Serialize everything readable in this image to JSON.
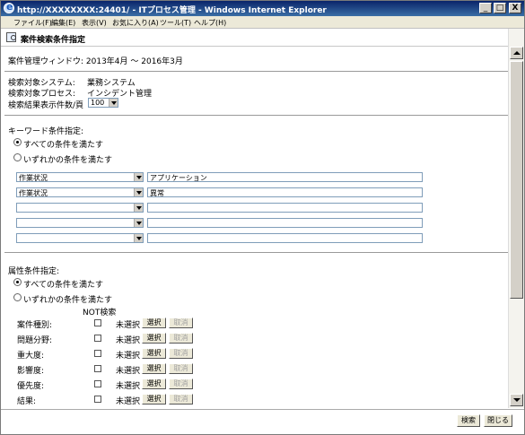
{
  "window": {
    "title": "http://XXXXXXXX:24401/ - ITプロセス管理 - Windows Internet Explorer",
    "minimize": "_",
    "maximize": "□",
    "close": "X"
  },
  "menu": [
    "ファイル(F)",
    "編集(E)",
    "表示(V)",
    "お気に入り(A)",
    "ツール(T)",
    "ヘルプ(H)"
  ],
  "page": {
    "title": "案件検索条件指定"
  },
  "window_period": "案件管理ウィンドウ: 2013年4月 ～ 2016年3月",
  "search_target": {
    "system_label": "検索対象システム:",
    "system_value": "業務システム",
    "process_label": "検索対象プロセス:",
    "process_value": "インシデント管理",
    "count_label": "検索結果表示件数/頁",
    "count_value": "100"
  },
  "keyword": {
    "heading": "キーワード条件指定:",
    "radio_all": "すべての条件を満たす",
    "radio_any": "いずれかの条件を満たす",
    "selected": "all",
    "rows": [
      {
        "field": "作業状況",
        "value": "アプリケーション"
      },
      {
        "field": "作業状況",
        "value": "異常"
      },
      {
        "field": "",
        "value": ""
      },
      {
        "field": "",
        "value": ""
      },
      {
        "field": "",
        "value": ""
      }
    ]
  },
  "attribute": {
    "heading": "属性条件指定:",
    "radio_all": "すべての条件を満たす",
    "radio_any": "いずれかの条件を満たす",
    "selected": "all",
    "not_header": "NOT検索",
    "rows": [
      {
        "label": "案件種別:",
        "status": "未選択",
        "select": "選択",
        "cancel": "取消"
      },
      {
        "label": "問題分野:",
        "status": "未選択",
        "select": "選択",
        "cancel": "取消"
      },
      {
        "label": "重大度:",
        "status": "未選択",
        "select": "選択",
        "cancel": "取消"
      },
      {
        "label": "影響度:",
        "status": "未選択",
        "select": "選択",
        "cancel": "取消"
      },
      {
        "label": "優先度:",
        "status": "未選択",
        "select": "選択",
        "cancel": "取消"
      },
      {
        "label": "結果:",
        "status": "未選択",
        "select": "選択",
        "cancel": "取消"
      }
    ]
  },
  "footer": {
    "search": "検索",
    "close": "閉じる"
  }
}
